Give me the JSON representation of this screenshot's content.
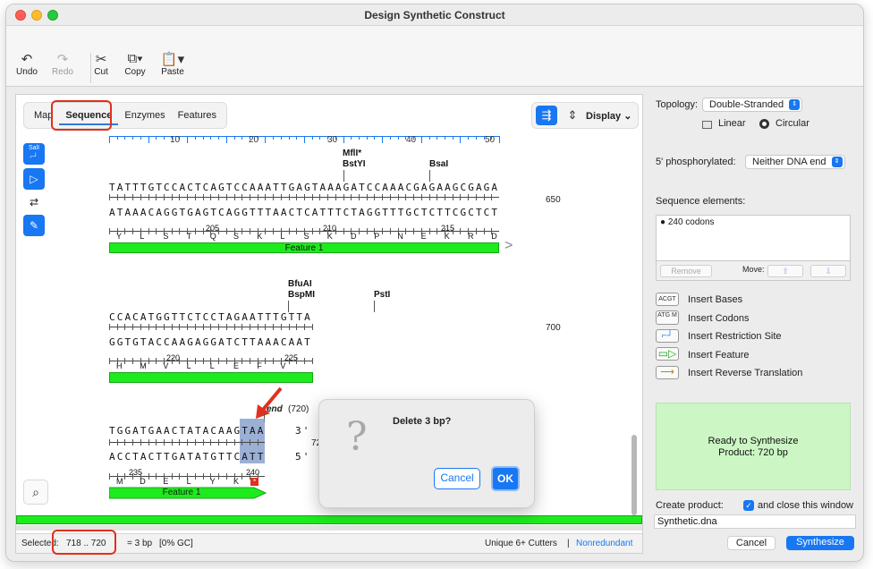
{
  "window": {
    "title": "Design Synthetic Construct"
  },
  "toolbar": {
    "undo": {
      "icon": "undo-icon",
      "label": "Undo"
    },
    "redo": {
      "icon": "redo-icon",
      "label": "Redo"
    },
    "cut": {
      "icon": "scissors-icon",
      "label": "Cut"
    },
    "copy": {
      "icon": "copy-icon",
      "label": "Copy"
    },
    "paste": {
      "icon": "paste-icon",
      "label": "Paste"
    }
  },
  "tabs": [
    "Map",
    "Sequence",
    "Enzymes",
    "Features"
  ],
  "active_tab": "Sequence",
  "display_label": "Display",
  "tools": {
    "sall": "SalI"
  },
  "ruler": [
    "10",
    "20",
    "30",
    "40",
    "50"
  ],
  "block1": {
    "enzymes": [
      "MflI*",
      "BstYI",
      "BsaI"
    ],
    "top": "TATTTGTCCACTCAGTCCAAATTGAGTAAAGATCCAAACGAGAAGCGAGA",
    "bottom": "ATAAACAGGTGAGTCAGGTTTAACTCATTTCTAGGTTTGCTCTTCGCTCT",
    "rownum": "650",
    "aanums": [
      "205",
      "210",
      "215"
    ],
    "aas": [
      "Y",
      "L",
      "S",
      "T",
      "Q",
      "S",
      "K",
      "L",
      "S",
      "K",
      "D",
      "P",
      "N",
      "E",
      "K",
      "R",
      "D"
    ],
    "feature": "Feature 1"
  },
  "block2": {
    "enzymes": [
      "BfuAI",
      "BspMI",
      "PstI"
    ],
    "top": "CCACATGGTTCTCCTAGAATTTGTTA",
    "bottom": "GGTGTACCAAGAGGATCTTAAACAAT",
    "rownum": "700",
    "aanums": [
      "220",
      "225"
    ],
    "aas": [
      "H",
      "M",
      "V",
      "L",
      "L",
      "E",
      "F",
      "V"
    ]
  },
  "block3": {
    "end_label": "end",
    "end_num": "(720)",
    "top": "TGGATGAACTATACAAGTAA",
    "top_suffix": "3'",
    "bottom": "ACCTACTTGATATGTTCATT",
    "bottom_suffix": "5'",
    "rownum": "720",
    "aanums": [
      "235",
      "240"
    ],
    "aas": [
      "M",
      "D",
      "E",
      "L",
      "Y",
      "K",
      "*"
    ],
    "feature": "Feature 1"
  },
  "dialog": {
    "message": "Delete 3 bp?",
    "cancel": "Cancel",
    "ok": "OK"
  },
  "status": {
    "selected_label": "Selected:",
    "range": "718 .. 720",
    "size": "= 3 bp",
    "gc": "[0% GC]",
    "cutters": "Unique 6+ Cutters",
    "sep": "|",
    "nonredundant": "Nonredundant"
  },
  "right": {
    "topology_label": "Topology:",
    "topology_value": "Double-Stranded",
    "linear": "Linear",
    "circular": "Circular",
    "phos_label": "5' phosphorylated:",
    "phos_value": "Neither DNA end",
    "elements_label": "Sequence elements:",
    "elements": [
      "240 codons"
    ],
    "remove": "Remove",
    "move": "Move:",
    "insert_items": [
      {
        "icon": "ACGT",
        "label": "Insert Bases"
      },
      {
        "icon": "ATG M",
        "label": "Insert Codons"
      },
      {
        "icon": "site",
        "label": "Insert Restriction Site"
      },
      {
        "icon": "feature",
        "label": "Insert Feature"
      },
      {
        "icon": "revtrans",
        "label": "Insert Reverse Translation"
      }
    ],
    "ready_line1": "Ready to Synthesize",
    "ready_line2": "Product: 720 bp",
    "create_label": "Create product:",
    "close_label": "and close this window",
    "filename": "Synthetic.dna",
    "cancel": "Cancel",
    "synthesize": "Synthesize"
  }
}
